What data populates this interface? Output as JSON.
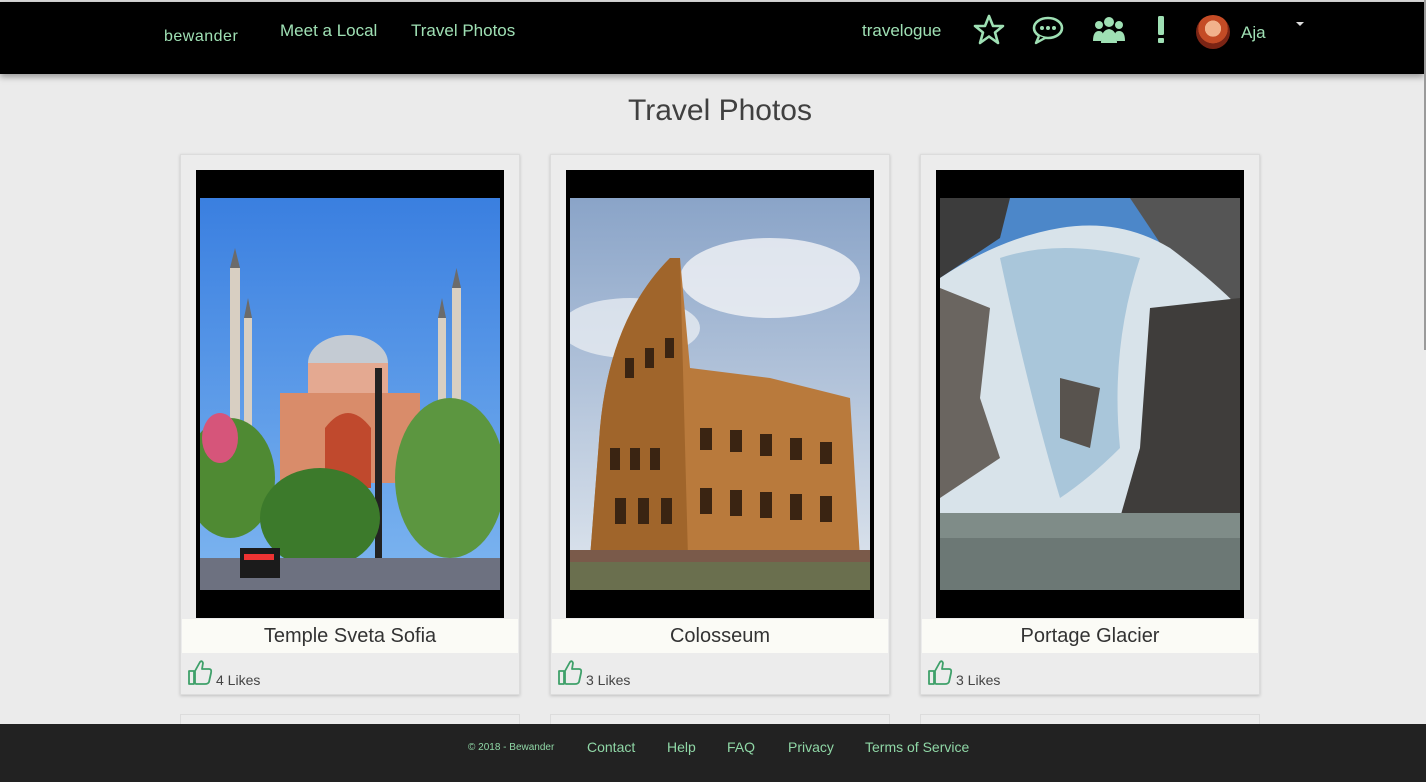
{
  "nav": {
    "brand": "bewander",
    "links": [
      "Meet a Local",
      "Travel Photos"
    ],
    "travelogue": "travelogue",
    "icons": [
      "star-icon",
      "chat-icon",
      "people-icon",
      "alert-icon"
    ],
    "user_name": "Aja"
  },
  "page_title": "Travel Photos",
  "cards": [
    {
      "title": "Temple Sveta Sofia",
      "likes": "4 Likes"
    },
    {
      "title": "Colosseum",
      "likes": "3 Likes"
    },
    {
      "title": "Portage Glacier",
      "likes": "3 Likes"
    }
  ],
  "footer": {
    "copyright": "© 2018 - Bewander",
    "links": [
      "Contact",
      "Help",
      "FAQ",
      "Privacy",
      "Terms of Service"
    ]
  },
  "colors": {
    "nav_bg": "#000000",
    "nav_text": "#9fe0b4",
    "footer_bg": "#222222",
    "footer_text": "#8fd7a6",
    "like_icon": "#3fa06a"
  }
}
